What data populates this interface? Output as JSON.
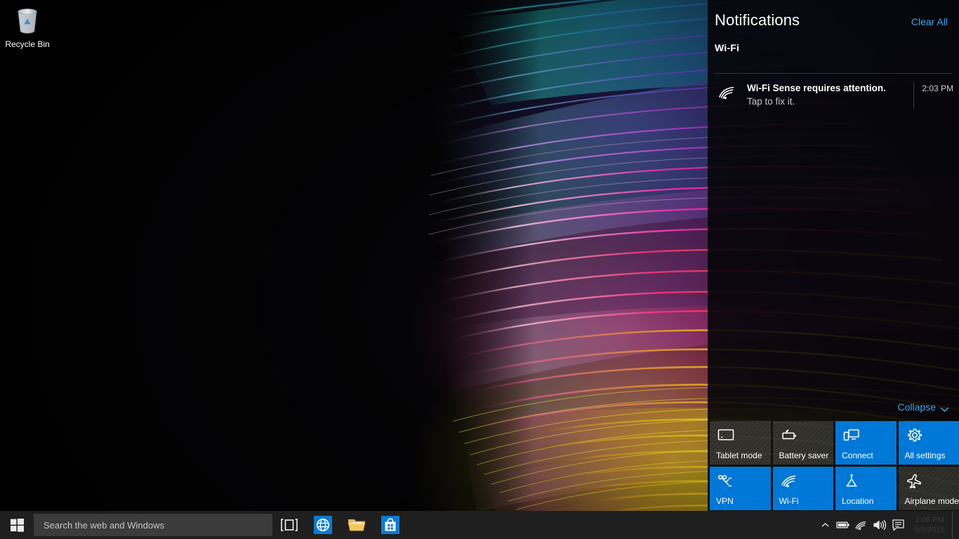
{
  "desktop": {
    "recycle_bin_label": "Recycle Bin",
    "recycle_bin_icon": "recycle-bin-icon"
  },
  "action_center": {
    "title": "Notifications",
    "clear_all_label": "Clear All",
    "collapse_label": "Collapse",
    "collapse_icon": "chevron-down-icon",
    "groups": [
      {
        "name": "Wi-Fi",
        "notifications": [
          {
            "icon": "wifi-icon",
            "title": "Wi-Fi Sense requires attention.",
            "body": "Tap to fix it.",
            "time": "2:03 PM"
          }
        ]
      }
    ],
    "quick_actions": [
      {
        "label": "Tablet mode",
        "icon": "tablet-icon",
        "state": "off"
      },
      {
        "label": "Battery saver",
        "icon": "battery-leaf-icon",
        "state": "off"
      },
      {
        "label": "Connect",
        "icon": "connect-icon",
        "state": "on"
      },
      {
        "label": "All settings",
        "icon": "gear-icon",
        "state": "on"
      },
      {
        "label": "VPN",
        "icon": "vpn-icon",
        "state": "on"
      },
      {
        "label": "Wi-Fi",
        "icon": "wifi-icon",
        "state": "on"
      },
      {
        "label": "Location",
        "icon": "location-icon",
        "state": "on"
      },
      {
        "label": "Airplane mode",
        "icon": "airplane-icon",
        "state": "off"
      }
    ],
    "accent_color": "#0078d7",
    "link_color": "#3ba6e8"
  },
  "taskbar": {
    "start_icon": "windows-logo-icon",
    "search_placeholder": "Search the web and Windows",
    "search_value": "",
    "buttons": [
      {
        "name": "task-view",
        "icon": "task-view-icon"
      },
      {
        "name": "edge",
        "icon": "edge-browser-icon"
      },
      {
        "name": "file-explorer",
        "icon": "folder-icon"
      },
      {
        "name": "store",
        "icon": "store-bag-icon"
      }
    ],
    "tray": [
      {
        "name": "show-hidden-icons",
        "icon": "chevron-up-icon"
      },
      {
        "name": "battery",
        "icon": "battery-icon"
      },
      {
        "name": "network",
        "icon": "wifi-icon"
      },
      {
        "name": "volume",
        "icon": "speaker-icon"
      },
      {
        "name": "action-center",
        "icon": "speech-bubble-icon"
      }
    ],
    "clock_time": "2:06 PM",
    "clock_date": "6/9/2015"
  }
}
